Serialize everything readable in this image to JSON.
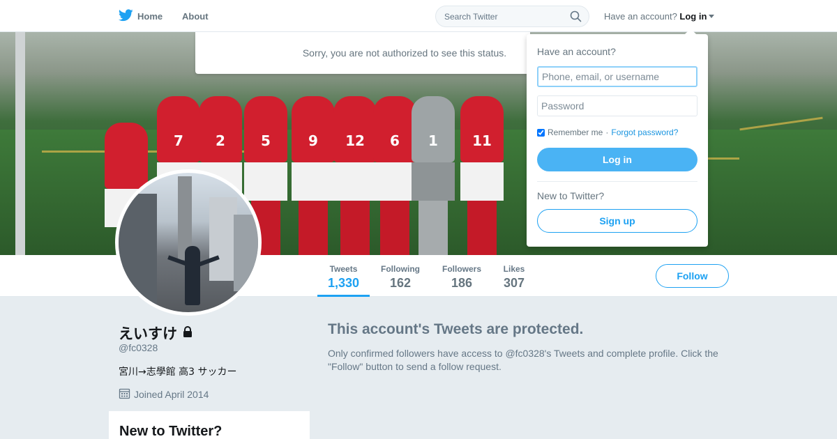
{
  "nav": {
    "home_label": "Home",
    "about_label": "About",
    "search_placeholder": "Search Twitter",
    "account_prompt": "Have an account?",
    "login_label": "Log in",
    "brand_color": "#1da1f2"
  },
  "alert": {
    "message": "Sorry, you are not authorized to see this status."
  },
  "banner": {
    "jersey_numbers": [
      "7",
      "2",
      "5",
      "9",
      "12",
      "6",
      "1",
      "11"
    ]
  },
  "stats": [
    {
      "label": "Tweets",
      "value": "1,330"
    },
    {
      "label": "Following",
      "value": "162"
    },
    {
      "label": "Followers",
      "value": "186"
    },
    {
      "label": "Likes",
      "value": "307"
    }
  ],
  "follow_label": "Follow",
  "profile": {
    "name": "えいすけ",
    "handle": "@fc0328",
    "bio": "宮川→志學館 高3 サッカー",
    "joined": "Joined April 2014"
  },
  "protected": {
    "title": "This account's Tweets are protected.",
    "text": "Only confirmed followers have access to @fc0328's Tweets and complete profile. Click the \"Follow\" button to send a follow request."
  },
  "sidebar_card": {
    "title": "New to Twitter?"
  },
  "login_dropdown": {
    "title": "Have an account?",
    "username_placeholder": "Phone, email, or username",
    "password_placeholder": "Password",
    "remember_label": "Remember me",
    "separator": "·",
    "forgot_label": "Forgot password?",
    "login_button": "Log in",
    "new_prompt": "New to Twitter?",
    "signup_button": "Sign up"
  }
}
